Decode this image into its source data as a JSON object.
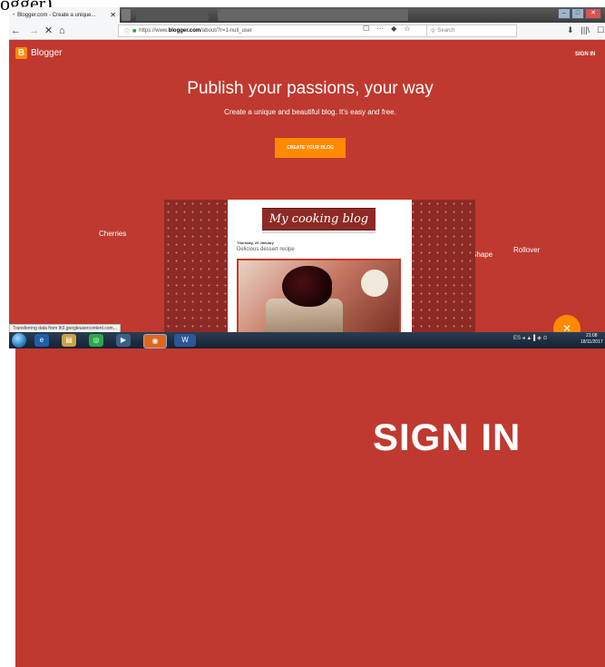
{
  "fragment": {
    "text": "ogger)."
  },
  "browser": {
    "tab_title": "Blogger.com - Create a unique...",
    "tab_close": "✕",
    "nav_back": "←",
    "nav_forward": "→",
    "nav_stop": "✕",
    "nav_home": "⌂",
    "url_prefix": "https://www.",
    "url_domain": "blogger.com",
    "url_path": "/about/?r=1-null_user",
    "url_tools": [
      "☐",
      "···",
      "◆",
      "☆"
    ],
    "search_placeholder": "Search",
    "right_tools": [
      "⬇",
      "|||\\",
      "☐"
    ],
    "window_buttons": [
      "–",
      "□",
      "✕"
    ]
  },
  "page": {
    "brand": "Blogger",
    "signin_small": "SIGN IN",
    "headline": "Publish your passions, your way",
    "subhead": "Create a unique and beautiful blog. It's easy and free.",
    "cta": "CREATE YOUR BLOG",
    "theme_left": "Cherries",
    "theme_right_partial": "Shape",
    "theme_right": "Rollover",
    "blog_title": "My cooking blog",
    "post_date": "Thursday, 20 January",
    "post_title": "Delicious dessert recipe",
    "fab": "✕",
    "status": "Transferring data from lh3.googleusercontent.com..."
  },
  "taskbar": {
    "icons": [
      "e",
      "▤",
      "◎",
      "▶",
      "◉",
      "W"
    ],
    "tray": "ES ◂ ▲ ▌◈ ⊙",
    "time": "21:08",
    "date": "18/11/2017"
  },
  "zoom": {
    "signin": "SIGN IN"
  },
  "colors": {
    "brand_red": "#bf392f",
    "orange": "#ff8a00",
    "dark_red": "#8e2a25"
  }
}
